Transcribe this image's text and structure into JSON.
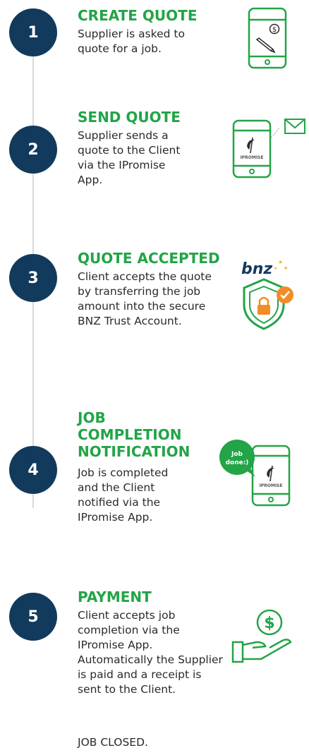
{
  "colors": {
    "accent_green": "#22a447",
    "circle_blue": "#123a5c",
    "orange": "#f28c28"
  },
  "steps": [
    {
      "number": "1",
      "title": "CREATE QUOTE",
      "description": "Supplier is asked to quote for a job.",
      "icon": "phone-dollar-pencil-icon"
    },
    {
      "number": "2",
      "title": "SEND QUOTE",
      "description": "Supplier sends a quote to the Client via the IPromise App.",
      "icon": "phone-ipromise-envelope-icon"
    },
    {
      "number": "3",
      "title": "QUOTE ACCEPTED",
      "description": "Client accepts the quote by transferring the job amount into the secure BNZ Trust Account.",
      "icon": "bnz-secure-shield-icon"
    },
    {
      "number": "4",
      "title": "JOB COMPLETION NOTIFICATION",
      "description": "Job is completed and the Client notified via the IPromise App.",
      "icon": "phone-job-done-icon"
    },
    {
      "number": "5",
      "title": "PAYMENT",
      "description": "Client accepts job completion via the IPromise App. Automatically the Supplier is paid and a receipt is sent to the Client.",
      "icon": "hand-dollar-icon"
    }
  ],
  "icon_text": {
    "app_brand": "IPROMISE",
    "bank_logo": "bnz",
    "job_done_bubble": "Job done:)",
    "dollar": "$"
  },
  "closing_text": "JOB CLOSED."
}
